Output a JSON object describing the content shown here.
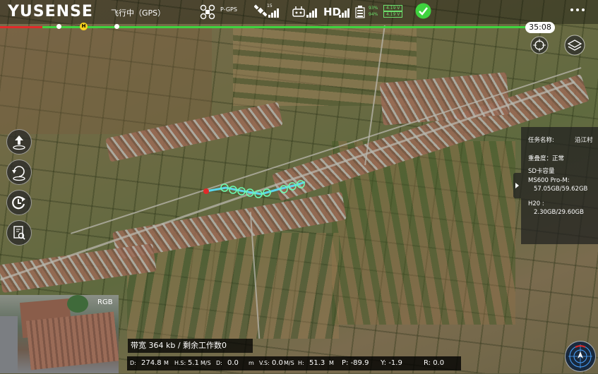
{
  "app": {
    "logo": "YUSENSE",
    "flight_status": "飞行中（GPS）",
    "gps_mode": "P-GPS",
    "satellite_count": "15",
    "video_quality": "HD",
    "battery": {
      "pct1": "93%",
      "pct2": "94%",
      "v1": "4.19 V",
      "v2": "4.19 V"
    },
    "menu_icon": "more-dots-icon",
    "status_ok_color": "#3fd33f"
  },
  "timeline": {
    "timer": "35:08",
    "home_marker": "H",
    "progress_color": "#3fd33f",
    "warning_color": "#e02a2a"
  },
  "mission_panel": {
    "task_label": "任务名称:",
    "task_name": "沿江村",
    "overlap": "重叠度：正常",
    "sd_title": "SD卡容量",
    "camera1_name": "MS600 Pro-M:",
    "camera1_cap": "57.05GB/59.62GB",
    "camera2_name": "H20 :",
    "camera2_cap": "2.30GB/29.60GB"
  },
  "pip": {
    "label": "RGB"
  },
  "info_bar": {
    "text": "带宽 364 kb / 剩余工作数0"
  },
  "telemetry": {
    "d_label": "D:",
    "d_val": "274.8",
    "d_unit": "M",
    "hs_label": "H.S:",
    "hs_val": "5.1",
    "hs_unit": "M/S",
    "d2_label": "D:",
    "d2_val": "0.0",
    "d2_unit": "m",
    "vs_label": "V.S:",
    "vs_val": "0.0",
    "vs_unit": "M/S",
    "h_label": "H:",
    "h_val": "51.3",
    "h_unit": "M",
    "p_text": "P: -89.9",
    "y_text": "Y: -1.9",
    "r_text": "R: 0.0"
  }
}
